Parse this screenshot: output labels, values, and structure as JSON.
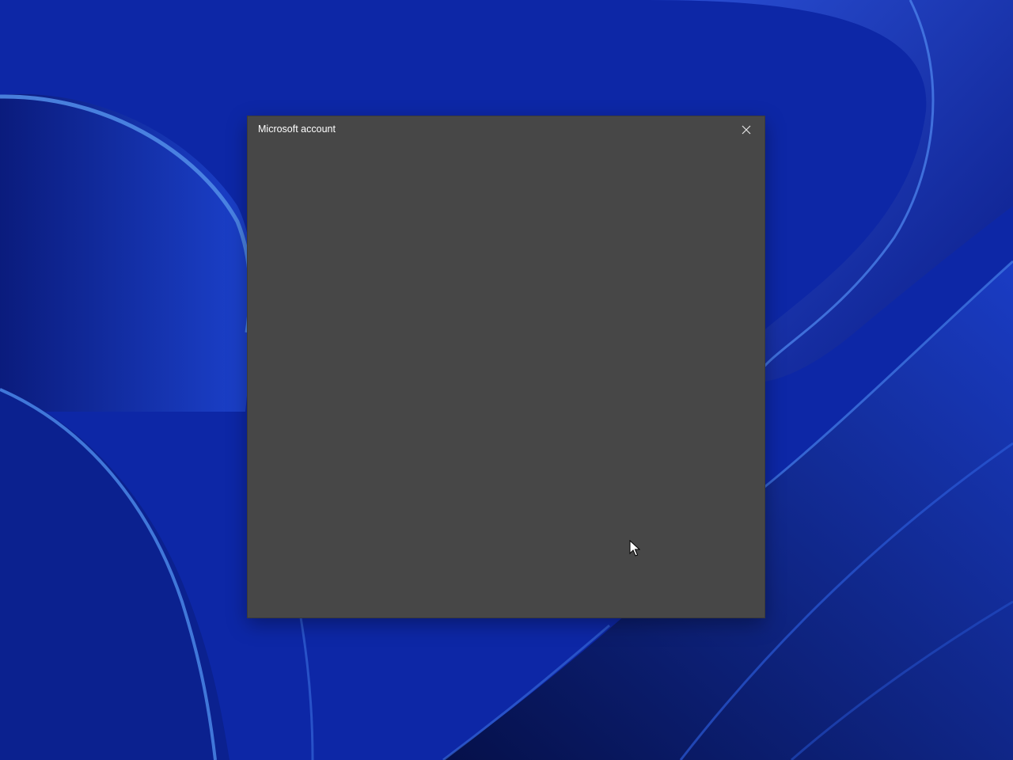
{
  "dialog": {
    "title": "Microsoft account",
    "close_icon": "close-icon",
    "background_color": "#474747",
    "title_color": "#ffffff"
  },
  "desktop": {
    "wallpaper_style": "blue-abstract-bloom",
    "accent_color": "#1230b8"
  },
  "cursor": {
    "icon": "arrow-cursor-icon"
  }
}
